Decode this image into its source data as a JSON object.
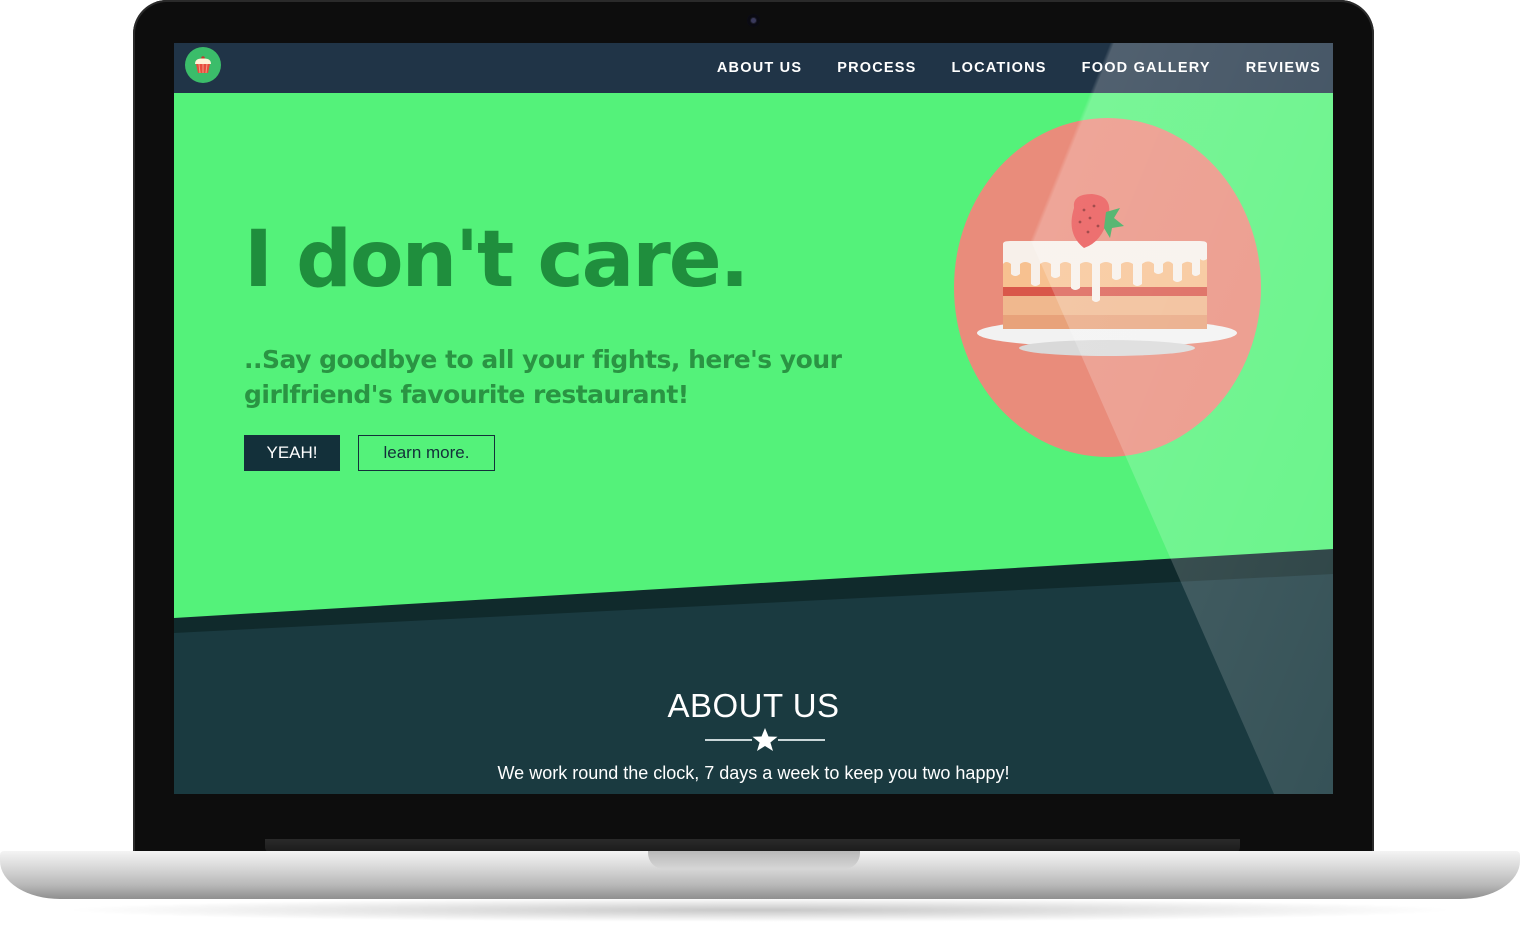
{
  "nav": {
    "links": [
      "ABOUT US",
      "PROCESS",
      "LOCATIONS",
      "FOOD GALLERY",
      "REVIEWS"
    ]
  },
  "hero": {
    "headline": "I don't care.",
    "subline": "..Say goodbye to all your fights, here's your girlfriend's favourite restaurant!",
    "primary_button": "YEAH!",
    "secondary_button": "learn more."
  },
  "about": {
    "title": "ABOUT US",
    "text": "We work round the clock, 7 days a week to keep you two happy!"
  },
  "icons": {
    "logo": "cupcake-logo-icon",
    "hero_image": "strawberry-cake-icon",
    "divider": "star-icon"
  },
  "colors": {
    "nav_bg": "#203447",
    "hero_bg": "#54f27a",
    "headline": "#1f8e3d",
    "section_bg": "#1a3a40",
    "circle": "#e98c7b",
    "button_dark": "#13303a"
  }
}
